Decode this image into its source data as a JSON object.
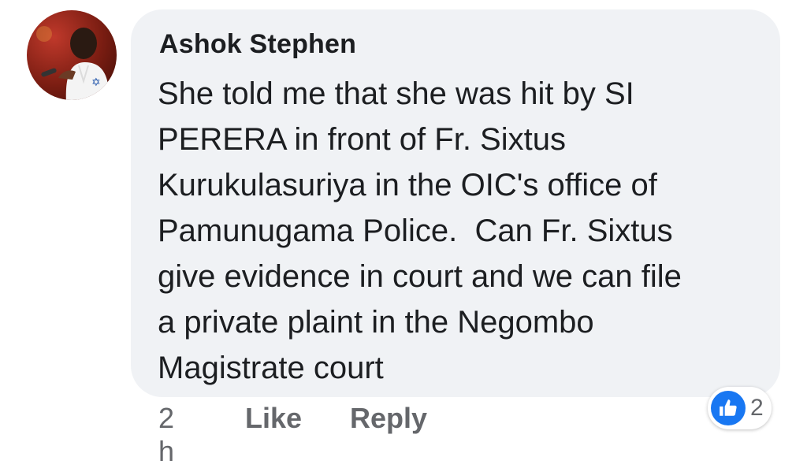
{
  "comment": {
    "author": "Ashok Stephen",
    "lines": [
      "She told me that she was hit by SI",
      "PERERA in front of Fr. Sixtus",
      "Kurukulasuriya in the OIC's office of",
      "Pamunugama Police.  Can Fr. Sixtus",
      "give evidence in court and we can file",
      "a private plaint in the Negombo",
      "Magistrate court"
    ],
    "timestamp": "2 h",
    "like_label": "Like",
    "reply_label": "Reply",
    "reaction_count": "2",
    "reaction_icon": "thumbs-up-icon"
  },
  "colors": {
    "bubble": "#f0f2f5",
    "text": "#1c1e21",
    "meta": "#65676b",
    "like_blue": "#1877f2"
  }
}
